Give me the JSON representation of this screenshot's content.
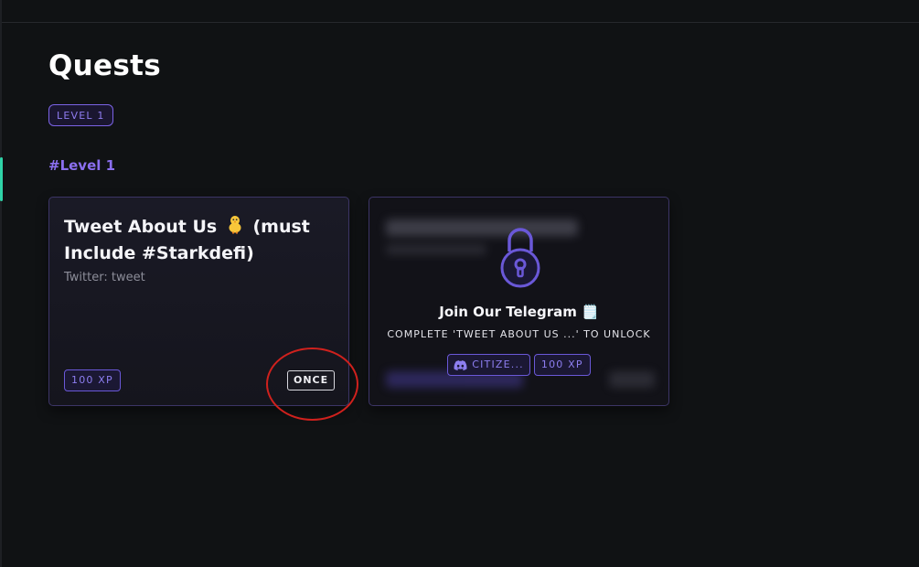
{
  "page": {
    "title": "Quests",
    "level_filter": "LEVEL 1",
    "section_heading": "#Level 1"
  },
  "quests": [
    {
      "title_part1": "Tweet About Us",
      "title_part2": "(must Include #Starkdefi)",
      "subtitle": "Twitter: tweet",
      "xp": "100 XP",
      "frequency": "ONCE",
      "icon": "baby-chick-emoji"
    },
    {
      "title": "Join Our Telegram 🗒️",
      "locked": true,
      "unlock_hint": "COMPLETE 'TWEET ABOUT US ...' TO UNLOCK",
      "role": "CITIZE...",
      "role_icon": "discord-icon",
      "xp": "100 XP",
      "lock_icon": "padlock-icon"
    }
  ],
  "colors": {
    "accent_purple": "#8b6ff0",
    "accent_green": "#2fd3a8",
    "annotation_red": "#d0211d",
    "background": "#101214"
  }
}
